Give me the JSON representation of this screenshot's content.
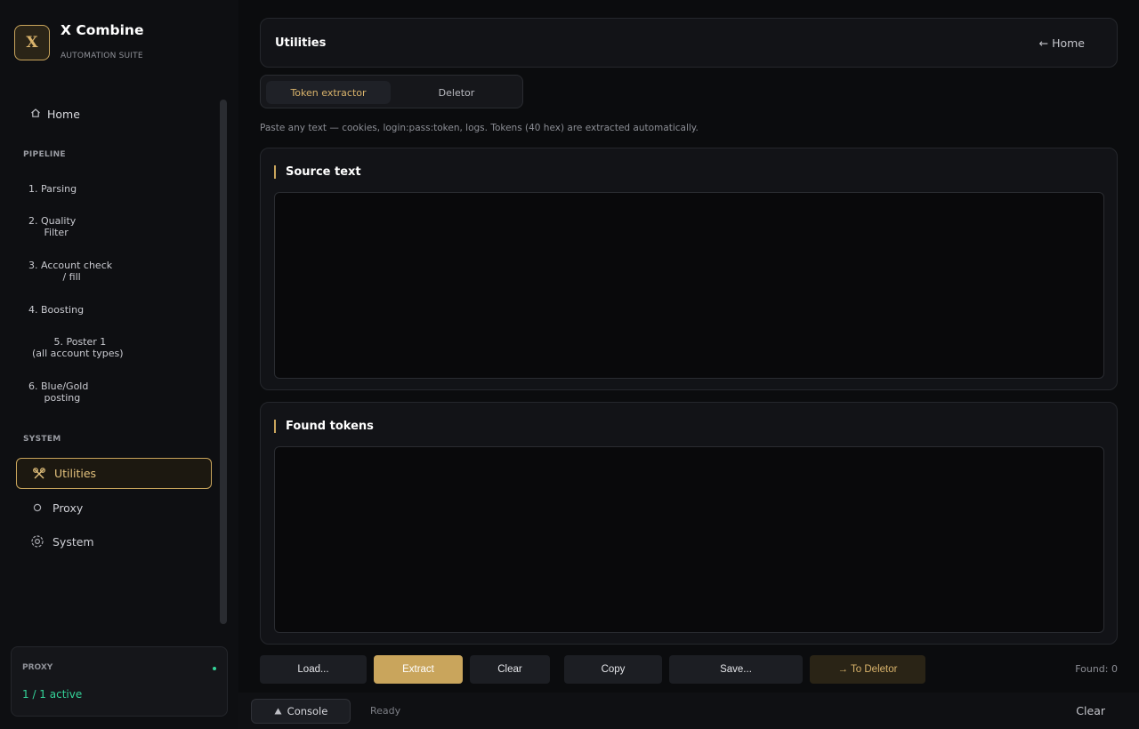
{
  "brand": {
    "logo_letter": "X",
    "title": "X Combine",
    "subtitle": "AUTOMATION SUITE"
  },
  "sidebar": {
    "home": {
      "icon": "home-icon",
      "label": "Home"
    },
    "pipeline_label": "PIPELINE",
    "pipeline": [
      "1. Parsing",
      "2. Quality\n     Filter",
      "3. Account check\n           / fill",
      "4. Boosting",
      "       5. Poster 1\n(all account types)",
      "6. Blue/Gold\n     posting"
    ],
    "system_label": "SYSTEM",
    "system": [
      {
        "icon": "tools-icon",
        "label": "Utilities",
        "active": true
      },
      {
        "icon": "circle-icon",
        "label": "Proxy"
      },
      {
        "icon": "gear-icon",
        "label": "System"
      }
    ],
    "proxy_card": {
      "label": "PROXY",
      "value": "1 / 1 active",
      "status_color": "#34d399"
    }
  },
  "header": {
    "title": "Utilities",
    "home_link": "← Home"
  },
  "tabs": [
    {
      "label": "Token extractor",
      "active": true
    },
    {
      "label": "Deletor",
      "active": false
    }
  ],
  "hint": "Paste any text — cookies, login:pass:token, logs. Tokens (40 hex) are extracted automatically.",
  "panels": {
    "source": {
      "title": "Source text",
      "value": ""
    },
    "found": {
      "title": "Found tokens",
      "value": ""
    }
  },
  "actions": {
    "load": "Load...",
    "extract": "Extract",
    "clear": "Clear",
    "copy": "Copy",
    "save": "Save...",
    "to_deletor": "→ To Deletor",
    "found": "Found: 0"
  },
  "statusbar": {
    "console": "Console",
    "console_icon": "triangle-up-icon",
    "status": "Ready",
    "clear": "Clear"
  },
  "colors": {
    "accent": "#c9a55c",
    "accent_text": "#d9b36b",
    "success": "#34d399",
    "background": "#0b0c0e"
  }
}
